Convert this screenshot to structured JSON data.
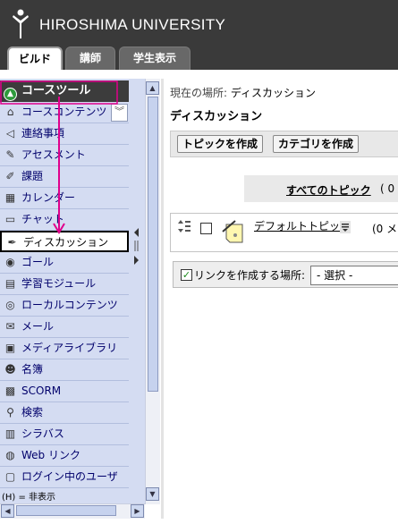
{
  "header": {
    "university": "HIROSHIMA UNIVERSITY"
  },
  "tabs": [
    {
      "label": "ビルド"
    },
    {
      "label": "講師"
    },
    {
      "label": "学生表示"
    }
  ],
  "sidebar": {
    "title": "コースツール",
    "items": [
      {
        "label": "コースコンテンツ",
        "icon": "house-icon"
      },
      {
        "label": "連絡事項",
        "icon": "megaphone-icon"
      },
      {
        "label": "アセスメント",
        "icon": "assessment-icon"
      },
      {
        "label": "課題",
        "icon": "assignment-icon"
      },
      {
        "label": "カレンダー",
        "icon": "calendar-icon"
      },
      {
        "label": "チャット",
        "icon": "chat-icon"
      },
      {
        "label": "ディスカッション",
        "icon": "discussion-icon"
      },
      {
        "label": "ゴール",
        "icon": "goal-icon"
      },
      {
        "label": "学習モジュール",
        "icon": "module-icon"
      },
      {
        "label": "ローカルコンテンツ",
        "icon": "disc-icon"
      },
      {
        "label": "メール",
        "icon": "mail-icon"
      },
      {
        "label": "メディアライブラリ",
        "icon": "media-icon"
      },
      {
        "label": "名簿",
        "icon": "roster-icon"
      },
      {
        "label": "SCORM",
        "icon": "scorm-icon"
      },
      {
        "label": "検索",
        "icon": "magnifier-icon"
      },
      {
        "label": "シラバス",
        "icon": "syllabus-icon"
      },
      {
        "label": "Web リンク",
        "icon": "globe-icon"
      },
      {
        "label": "ログイン中のユーザ",
        "icon": "user-icon"
      }
    ],
    "selected_index": 6,
    "legend": "(H) = 非表示"
  },
  "main": {
    "breadcrumb_label": "現在の場所:",
    "breadcrumb_value": "ディスカッション",
    "title": "ディスカッション",
    "buttons": {
      "create_topic": "トピックを作成",
      "create_category": "カテゴリを作成"
    },
    "all_topics": {
      "label": "すべてのトピック",
      "count": "( 0"
    },
    "topic": {
      "label": "デフォルトトピック",
      "count": "(0 メ"
    },
    "link_bar": {
      "label": "リンクを作成する場所:",
      "select_value": "- 選択 -"
    }
  },
  "colors": {
    "header_bg": "#3a3a3a",
    "nav_bg": "#d4dcf2",
    "accent_arrow": "#e0008c"
  }
}
